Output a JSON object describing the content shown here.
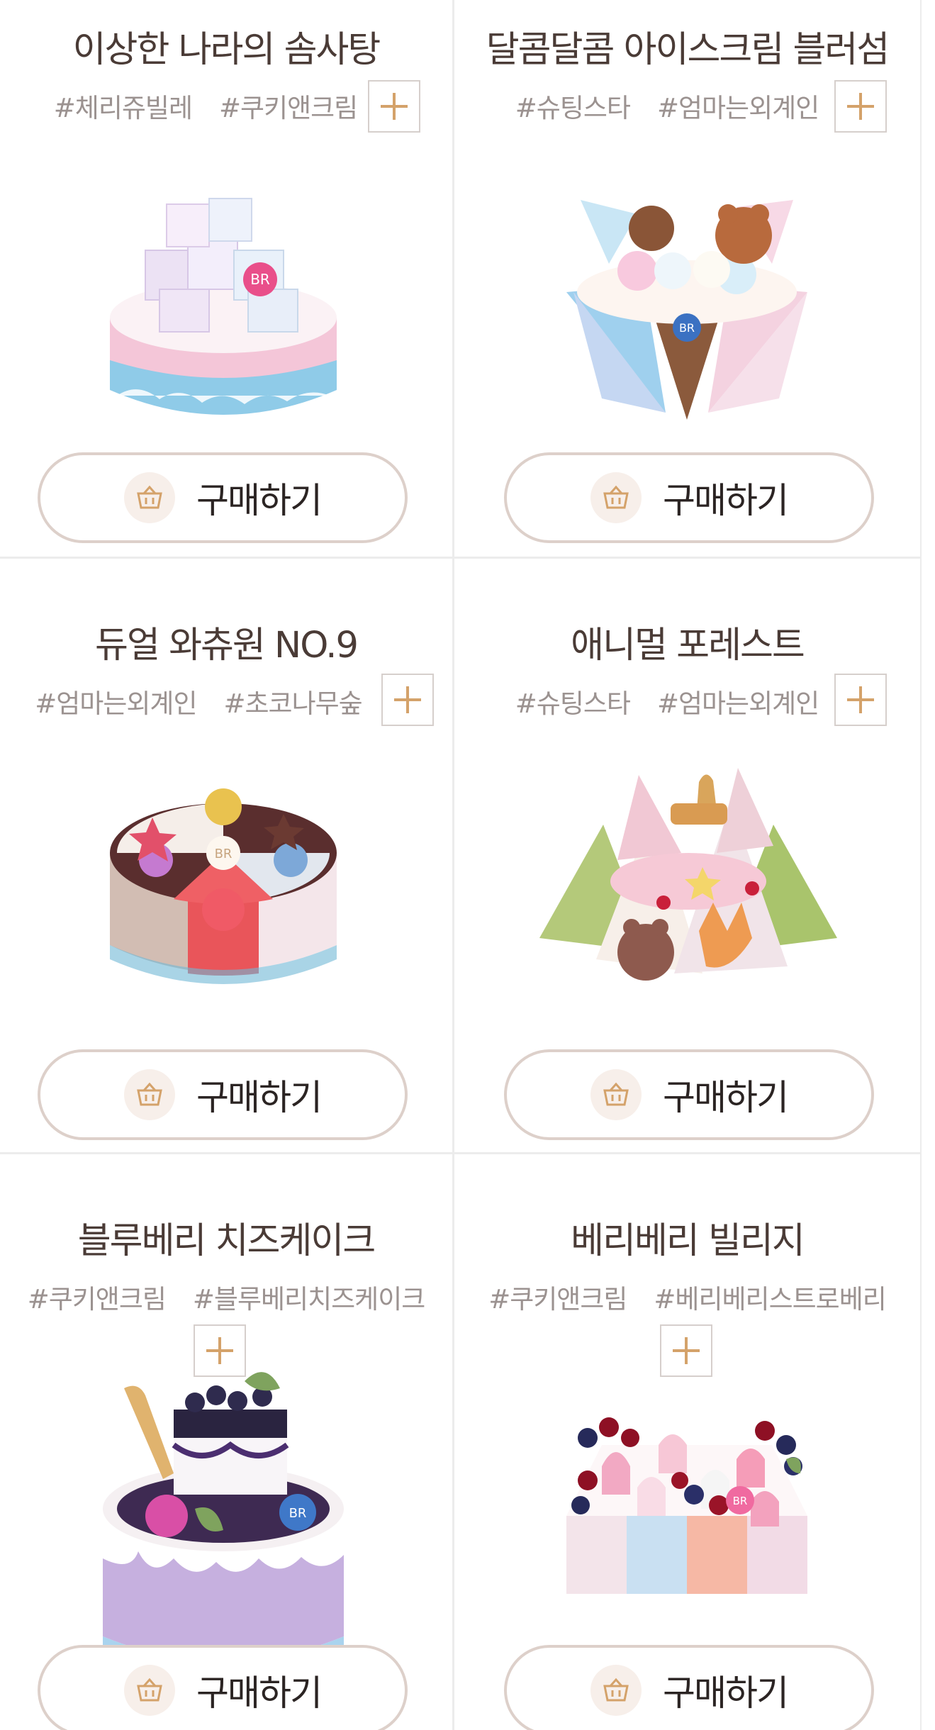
{
  "products": [
    {
      "name": "이상한 나라의 솜사탕",
      "tags": [
        "#체리쥬빌레",
        "#쿠키앤크림"
      ],
      "buy_label": "구매하기",
      "image": "cotton-candy-cake",
      "colors": {
        "accent": "#9fd3ee",
        "base": "#f4c6d8"
      }
    },
    {
      "name": "달콤달콤 아이스크림 블러섬",
      "tags": [
        "#슈팅스타",
        "#엄마는외계인"
      ],
      "buy_label": "구매하기",
      "image": "blossom-cake",
      "colors": {
        "accent": "#c7e4f6",
        "base": "#f2d4e2"
      }
    },
    {
      "name": "듀얼 와츄원 NO.9",
      "tags": [
        "#엄마는외계인",
        "#초코나무숲"
      ],
      "buy_label": "구매하기",
      "image": "dual-cake",
      "colors": {
        "accent": "#e25a5e",
        "base": "#f4e7ea"
      }
    },
    {
      "name": "애니멀 포레스트",
      "tags": [
        "#슈팅스타",
        "#엄마는외계인"
      ],
      "buy_label": "구매하기",
      "image": "animal-forest-cake",
      "colors": {
        "accent": "#a8c46a",
        "base": "#f2d0d8"
      }
    },
    {
      "name": "블루베리 치즈케이크",
      "tags": [
        "#쿠키앤크림",
        "#블루베리치즈케이크"
      ],
      "buy_label": "구매하기",
      "image": "blueberry-cheese-cake",
      "colors": {
        "accent": "#b59ad2",
        "base": "#e4daf0"
      }
    },
    {
      "name": "베리베리 빌리지",
      "tags": [
        "#쿠키앤크림",
        "#베리베리스트로베리"
      ],
      "buy_label": "구매하기",
      "image": "berry-village-cake",
      "colors": {
        "accent": "#e68bb0",
        "base": "#f8e6ee"
      }
    }
  ],
  "icons": {
    "add": "plus-icon",
    "cart": "basket-icon"
  },
  "theme": {
    "accent": "#d4a26a",
    "border": "#ddd0ca",
    "text": "#4a3b36",
    "tag": "#9b9290"
  }
}
